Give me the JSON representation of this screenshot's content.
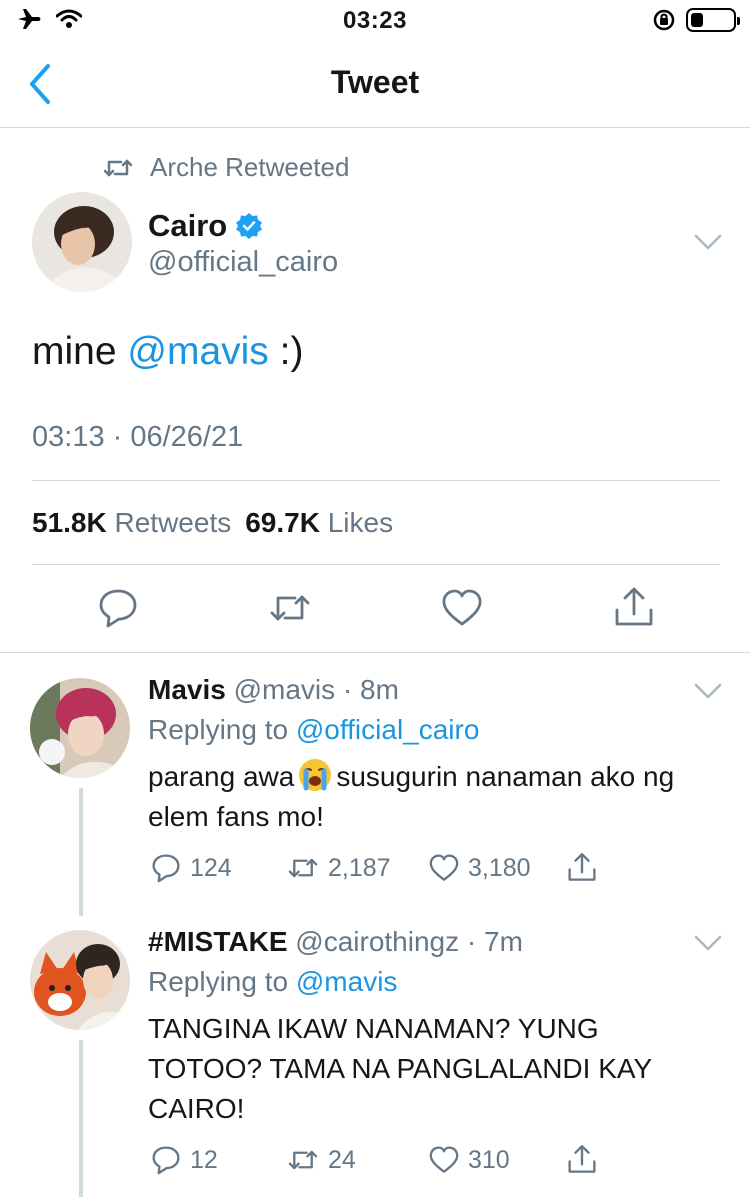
{
  "status_bar": {
    "time": "03:23"
  },
  "nav": {
    "title": "Tweet"
  },
  "tweet": {
    "retweeted_by": "Arche Retweeted",
    "author_name": "Cairo",
    "author_handle": "@official_cairo",
    "text_before": "mine ",
    "mention": "@mavis",
    "text_after": " :)",
    "timestamp": "03:13 · 06/26/21",
    "retweet_count": "51.8K",
    "retweet_label": "Retweets",
    "like_count": "69.7K",
    "like_label": "Likes"
  },
  "replies": [
    {
      "name": "Mavis",
      "handle_time": "@mavis · 8m",
      "replying_label": "Replying to",
      "replying_to": "@official_cairo",
      "text_part1": "parang awa",
      "emoji": "crying-face",
      "text_part2": "susugurin nanaman ako ng elem fans mo!",
      "replies": "124",
      "retweets": "2,187",
      "likes": "3,180"
    },
    {
      "name": "#MISTAKE",
      "handle_time": "@cairothingz · 7m",
      "replying_label": "Replying to",
      "replying_to": "@mavis",
      "text": "TANGINA IKAW NANAMAN? YUNG TOTOO? TAMA NA PANGLALANDI KAY CAIRO!",
      "replies": "12",
      "retweets": "24",
      "likes": "310"
    }
  ],
  "colors": {
    "link": "#1b95e0",
    "secondary": "#657786",
    "verified": "#1da1f2"
  }
}
